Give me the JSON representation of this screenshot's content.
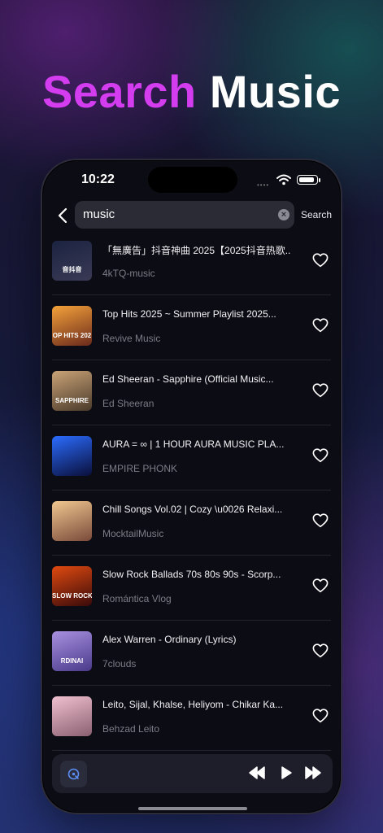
{
  "headline": {
    "accent": "Search",
    "plain": "Music"
  },
  "status_bar": {
    "time": "10:22",
    "signal_text": "••••"
  },
  "search": {
    "query": "music",
    "clear_icon": "×",
    "action_label": "Search"
  },
  "results": [
    {
      "title": "「無廣告」抖音神曲 2025【2025抖音热歌...",
      "artist": "4kTQ-music",
      "thumb_text": "音抖音",
      "thumb_colors": [
        "#1b2340",
        "#3a3a55"
      ]
    },
    {
      "title": "Top Hits 2025 ~ Summer Playlist 2025...",
      "artist": "Revive Music",
      "thumb_text": "OP HITS 202",
      "thumb_colors": [
        "#f4a23a",
        "#6b2a1c"
      ]
    },
    {
      "title": "Ed Sheeran - Sapphire (Official Music...",
      "artist": "Ed Sheeran",
      "thumb_text": "SAPPHIRE",
      "thumb_colors": [
        "#c9a377",
        "#4a3a2a"
      ]
    },
    {
      "title": "AURA = ∞ | 1 HOUR AURA MUSIC PLA...",
      "artist": "EMPIRE PHONK",
      "thumb_text": "",
      "thumb_colors": [
        "#2b6cff",
        "#0a0f3a"
      ]
    },
    {
      "title": "Chill Songs Vol.02 | Cozy \\u0026 Relaxi...",
      "artist": "MocktailMusic",
      "thumb_text": "",
      "thumb_colors": [
        "#f0c890",
        "#7a4a3a"
      ]
    },
    {
      "title": "Slow Rock Ballads 70s 80s 90s - Scorp...",
      "artist": "Romántica Vlog",
      "thumb_text": "SLOW ROCK",
      "thumb_colors": [
        "#e04a10",
        "#3a0a0a"
      ]
    },
    {
      "title": "Alex Warren - Ordinary (Lyrics)",
      "artist": "7clouds",
      "thumb_text": "RDINAl",
      "thumb_colors": [
        "#a890e0",
        "#4a3a8a"
      ]
    },
    {
      "title": "Leito, Sijal, Khalse, Heliyom - Chikar Ka...",
      "artist": "Behzad Leito",
      "thumb_text": "",
      "thumb_colors": [
        "#f0c0d0",
        "#8a6070"
      ]
    }
  ],
  "colors": {
    "accent": "#d43cf0",
    "background": "#0c0c14",
    "player_accent": "#5b8df0"
  },
  "icons": {
    "back": "chevron-left-icon",
    "favorite": "heart-icon",
    "wifi": "wifi-icon",
    "battery": "battery-icon",
    "previous": "rewind-icon",
    "play": "play-icon",
    "next": "fast-forward-icon",
    "now_playing": "disc-icon"
  }
}
